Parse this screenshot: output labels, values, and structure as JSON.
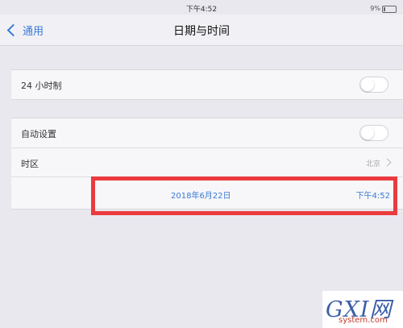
{
  "status_bar": {
    "time": "下午4:52",
    "battery": "9%"
  },
  "nav": {
    "back_label": "通用",
    "title": "日期与时间"
  },
  "settings": {
    "hour24": {
      "label": "24 小时制",
      "on": false
    },
    "auto_set": {
      "label": "自动设置",
      "on": false
    },
    "time_zone": {
      "label": "时区",
      "value": "北京"
    },
    "datetime": {
      "date": "2018年6月22日",
      "time": "下午4:52"
    }
  },
  "watermark": {
    "main": "GXI网",
    "sub": "system.com"
  },
  "colors": {
    "accent": "#3a7ad6",
    "highlight": "#ea3b3f"
  }
}
